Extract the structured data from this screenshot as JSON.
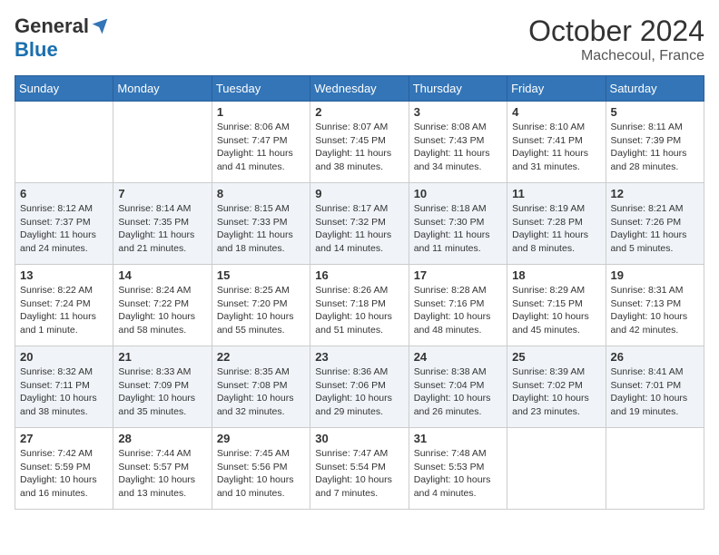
{
  "header": {
    "logo_general": "General",
    "logo_blue": "Blue",
    "month_title": "October 2024",
    "location": "Machecoul, France"
  },
  "weekdays": [
    "Sunday",
    "Monday",
    "Tuesday",
    "Wednesday",
    "Thursday",
    "Friday",
    "Saturday"
  ],
  "weeks": [
    [
      {
        "day": "",
        "info": ""
      },
      {
        "day": "",
        "info": ""
      },
      {
        "day": "1",
        "info": "Sunrise: 8:06 AM\nSunset: 7:47 PM\nDaylight: 11 hours and 41 minutes."
      },
      {
        "day": "2",
        "info": "Sunrise: 8:07 AM\nSunset: 7:45 PM\nDaylight: 11 hours and 38 minutes."
      },
      {
        "day": "3",
        "info": "Sunrise: 8:08 AM\nSunset: 7:43 PM\nDaylight: 11 hours and 34 minutes."
      },
      {
        "day": "4",
        "info": "Sunrise: 8:10 AM\nSunset: 7:41 PM\nDaylight: 11 hours and 31 minutes."
      },
      {
        "day": "5",
        "info": "Sunrise: 8:11 AM\nSunset: 7:39 PM\nDaylight: 11 hours and 28 minutes."
      }
    ],
    [
      {
        "day": "6",
        "info": "Sunrise: 8:12 AM\nSunset: 7:37 PM\nDaylight: 11 hours and 24 minutes."
      },
      {
        "day": "7",
        "info": "Sunrise: 8:14 AM\nSunset: 7:35 PM\nDaylight: 11 hours and 21 minutes."
      },
      {
        "day": "8",
        "info": "Sunrise: 8:15 AM\nSunset: 7:33 PM\nDaylight: 11 hours and 18 minutes."
      },
      {
        "day": "9",
        "info": "Sunrise: 8:17 AM\nSunset: 7:32 PM\nDaylight: 11 hours and 14 minutes."
      },
      {
        "day": "10",
        "info": "Sunrise: 8:18 AM\nSunset: 7:30 PM\nDaylight: 11 hours and 11 minutes."
      },
      {
        "day": "11",
        "info": "Sunrise: 8:19 AM\nSunset: 7:28 PM\nDaylight: 11 hours and 8 minutes."
      },
      {
        "day": "12",
        "info": "Sunrise: 8:21 AM\nSunset: 7:26 PM\nDaylight: 11 hours and 5 minutes."
      }
    ],
    [
      {
        "day": "13",
        "info": "Sunrise: 8:22 AM\nSunset: 7:24 PM\nDaylight: 11 hours and 1 minute."
      },
      {
        "day": "14",
        "info": "Sunrise: 8:24 AM\nSunset: 7:22 PM\nDaylight: 10 hours and 58 minutes."
      },
      {
        "day": "15",
        "info": "Sunrise: 8:25 AM\nSunset: 7:20 PM\nDaylight: 10 hours and 55 minutes."
      },
      {
        "day": "16",
        "info": "Sunrise: 8:26 AM\nSunset: 7:18 PM\nDaylight: 10 hours and 51 minutes."
      },
      {
        "day": "17",
        "info": "Sunrise: 8:28 AM\nSunset: 7:16 PM\nDaylight: 10 hours and 48 minutes."
      },
      {
        "day": "18",
        "info": "Sunrise: 8:29 AM\nSunset: 7:15 PM\nDaylight: 10 hours and 45 minutes."
      },
      {
        "day": "19",
        "info": "Sunrise: 8:31 AM\nSunset: 7:13 PM\nDaylight: 10 hours and 42 minutes."
      }
    ],
    [
      {
        "day": "20",
        "info": "Sunrise: 8:32 AM\nSunset: 7:11 PM\nDaylight: 10 hours and 38 minutes."
      },
      {
        "day": "21",
        "info": "Sunrise: 8:33 AM\nSunset: 7:09 PM\nDaylight: 10 hours and 35 minutes."
      },
      {
        "day": "22",
        "info": "Sunrise: 8:35 AM\nSunset: 7:08 PM\nDaylight: 10 hours and 32 minutes."
      },
      {
        "day": "23",
        "info": "Sunrise: 8:36 AM\nSunset: 7:06 PM\nDaylight: 10 hours and 29 minutes."
      },
      {
        "day": "24",
        "info": "Sunrise: 8:38 AM\nSunset: 7:04 PM\nDaylight: 10 hours and 26 minutes."
      },
      {
        "day": "25",
        "info": "Sunrise: 8:39 AM\nSunset: 7:02 PM\nDaylight: 10 hours and 23 minutes."
      },
      {
        "day": "26",
        "info": "Sunrise: 8:41 AM\nSunset: 7:01 PM\nDaylight: 10 hours and 19 minutes."
      }
    ],
    [
      {
        "day": "27",
        "info": "Sunrise: 7:42 AM\nSunset: 5:59 PM\nDaylight: 10 hours and 16 minutes."
      },
      {
        "day": "28",
        "info": "Sunrise: 7:44 AM\nSunset: 5:57 PM\nDaylight: 10 hours and 13 minutes."
      },
      {
        "day": "29",
        "info": "Sunrise: 7:45 AM\nSunset: 5:56 PM\nDaylight: 10 hours and 10 minutes."
      },
      {
        "day": "30",
        "info": "Sunrise: 7:47 AM\nSunset: 5:54 PM\nDaylight: 10 hours and 7 minutes."
      },
      {
        "day": "31",
        "info": "Sunrise: 7:48 AM\nSunset: 5:53 PM\nDaylight: 10 hours and 4 minutes."
      },
      {
        "day": "",
        "info": ""
      },
      {
        "day": "",
        "info": ""
      }
    ]
  ]
}
